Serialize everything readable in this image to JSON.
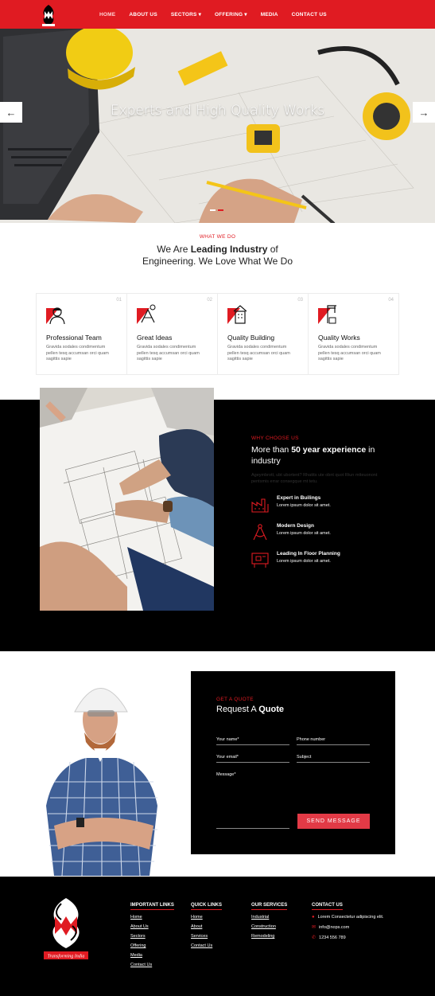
{
  "nav": {
    "items": [
      {
        "label": "HOME",
        "active": true
      },
      {
        "label": "ABOUT US"
      },
      {
        "label": "SECTORS ▾"
      },
      {
        "label": "OFFERING ▾"
      },
      {
        "label": "MEDIA"
      },
      {
        "label": "CONTACT US"
      }
    ]
  },
  "hero": {
    "title": "Experts and High Quality Works",
    "prev_icon": "arrow-left-icon",
    "next_icon": "arrow-right-icon"
  },
  "what": {
    "kicker": "WHAT WE DO",
    "line1_pre": "We Are ",
    "line1_bold": "Leading Industry",
    "line1_post": " of",
    "line2": "Engineering. We Love What We Do"
  },
  "features": [
    {
      "num": "01",
      "title": "Professional Team",
      "text": "Gravida sodales condimentum pellen tesq accumsan orci quam sagittis sapie",
      "icon": "engineer-icon"
    },
    {
      "num": "02",
      "title": "Great Ideas",
      "text": "Gravida sodales condimentum pellen tesq accumsan orci quam sagittis sapie",
      "icon": "idea-tools-icon"
    },
    {
      "num": "03",
      "title": "Quality Building",
      "text": "Gravida sodales condimentum pellen tesq accumsan orci quam sagittis sapie",
      "icon": "building-icon"
    },
    {
      "num": "04",
      "title": "Quality Works",
      "text": "Gravida sodales condimentum pellen tesq accumsan orci quam sagittis sapie",
      "icon": "crane-icon"
    }
  ],
  "why": {
    "kicker": "WHY CHOOSE US",
    "title_pre": "More than ",
    "title_bold": "50 year experience",
    "title_post": " in industry",
    "faded": "Ageymbrott, ubt ubortent? Rhattts ute obnt quot Rtun mtteuonont pentsmis errar consegque mt tetu.",
    "items": [
      {
        "title": "Expert in Builings",
        "text": "Lorem ipsum dolor sit amet.",
        "icon": "factory-icon"
      },
      {
        "title": "Modern Design",
        "text": "Lorem ipsum dolor sit amet.",
        "icon": "compass-icon"
      },
      {
        "title": "Leading In Floor Planning",
        "text": "Lorem ipsum dolor sit amet.",
        "icon": "blueprint-icon"
      }
    ]
  },
  "quote": {
    "kicker": "GET A QUOTE",
    "title_pre": "Request A ",
    "title_bold": "Quote",
    "name": "Your name*",
    "phone": "Phone number",
    "email": "Your email*",
    "subject": "Subject",
    "message": "Message*",
    "button": "SEND MESSAGE"
  },
  "footer": {
    "logo_caption": "Transforming India",
    "important": {
      "title": "IMPORTANT LINKS",
      "links": [
        "Home",
        "About Us",
        "Sectors",
        "Offering",
        "Media",
        "Contact Us"
      ]
    },
    "quick": {
      "title": "QUICK LINKS",
      "links": [
        "Home",
        "About",
        "Services",
        "Contact Us"
      ]
    },
    "services": {
      "title": "OUR SERVICES",
      "links": [
        "Industrial",
        "Construction",
        "Remodeling"
      ]
    },
    "contact": {
      "title": "CONTACT US",
      "address": "Lorem Consectetur adipiscing elit.",
      "email": "info@nops.com",
      "phone": "1234 556 789"
    }
  },
  "colors": {
    "brand_red": "#e01b22",
    "button_red": "#e23a46",
    "dark": "#000000"
  }
}
